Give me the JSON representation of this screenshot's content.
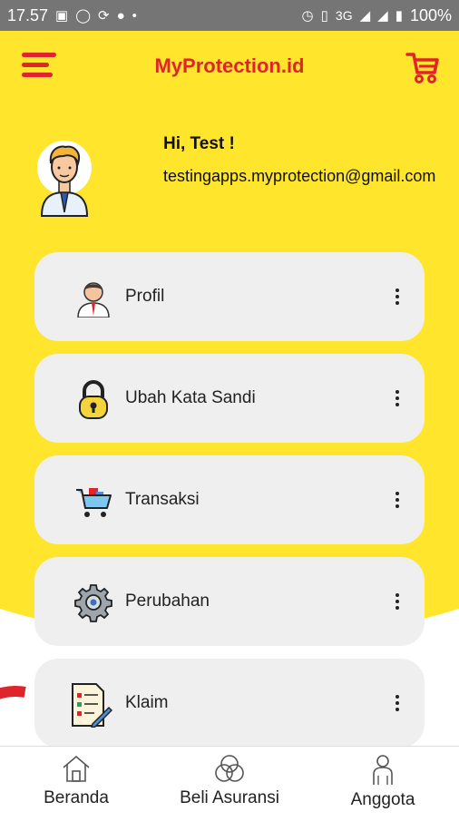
{
  "statusbar": {
    "time": "17.57",
    "network": "3G",
    "battery": "100%"
  },
  "appbar": {
    "title": "MyProtection.id",
    "menu_icon": "hamburger-icon",
    "cart_icon": "cart-icon"
  },
  "profile": {
    "greeting": "Hi, Test !",
    "email": "testingapps.myprotection@gmail.com"
  },
  "menu": {
    "items": [
      {
        "label": "Profil",
        "icon": "person-icon"
      },
      {
        "label": "Ubah Kata Sandi",
        "icon": "padlock-icon"
      },
      {
        "label": "Transaksi",
        "icon": "shopping-cart-icon"
      },
      {
        "label": "Perubahan",
        "icon": "gear-icon"
      },
      {
        "label": "Klaim",
        "icon": "document-icon"
      }
    ]
  },
  "bottom_nav": {
    "items": [
      {
        "label": "Beranda",
        "icon": "home-icon"
      },
      {
        "label": "Beli Asuransi",
        "icon": "circles-icon"
      },
      {
        "label": "Anggota",
        "icon": "user-icon"
      }
    ]
  },
  "colors": {
    "brand_yellow": "#FFE52B",
    "brand_red": "#E0242C",
    "card_bg": "#EFEFEF"
  }
}
